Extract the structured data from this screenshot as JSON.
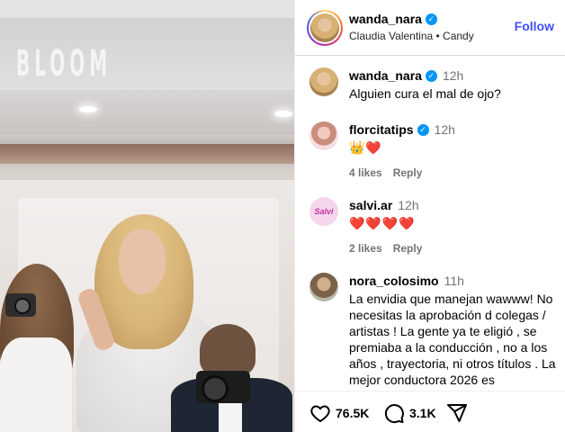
{
  "post": {
    "photo_sign_text": "BLOOM"
  },
  "header": {
    "username": "wanda_nara",
    "verified_mark": "✓",
    "music": "Claudia Valentina • Candy",
    "follow_label": "Follow"
  },
  "comments": [
    {
      "username": "wanda_nara",
      "verified": true,
      "time": "12h",
      "text": "Alguien cura el mal de ojo?",
      "avatar": "wanda-avatar"
    },
    {
      "username": "florcitatips",
      "verified": true,
      "time": "12h",
      "text": "👑❤️",
      "likes": "4 likes",
      "reply": "Reply",
      "avatar": "florcitatips-avatar"
    },
    {
      "username": "salvi.ar",
      "verified": false,
      "time": "12h",
      "text": "❤️❤️❤️❤️",
      "likes": "2 likes",
      "reply": "Reply",
      "avatar_text": "Salvi",
      "avatar": "salvi-avatar"
    },
    {
      "username": "nora_colosimo",
      "verified": false,
      "time": "11h",
      "text": "La envidia que manejan wawww! No necesitas la aprobación d colegas / artistas ! La gente ya te eligió , se premiaba a la conducción , no a los años , trayectoria, ni otros títulos . La mejor conductora 2026 es",
      "avatar": "nora-avatar"
    }
  ],
  "footer": {
    "likes_count": "76.5K",
    "comments_count": "3.1K",
    "icons": [
      "heart-icon",
      "comment-icon",
      "share-icon"
    ]
  },
  "colors": {
    "follow": "#4150f7",
    "verified": "#0095f6",
    "muted": "#737373"
  }
}
